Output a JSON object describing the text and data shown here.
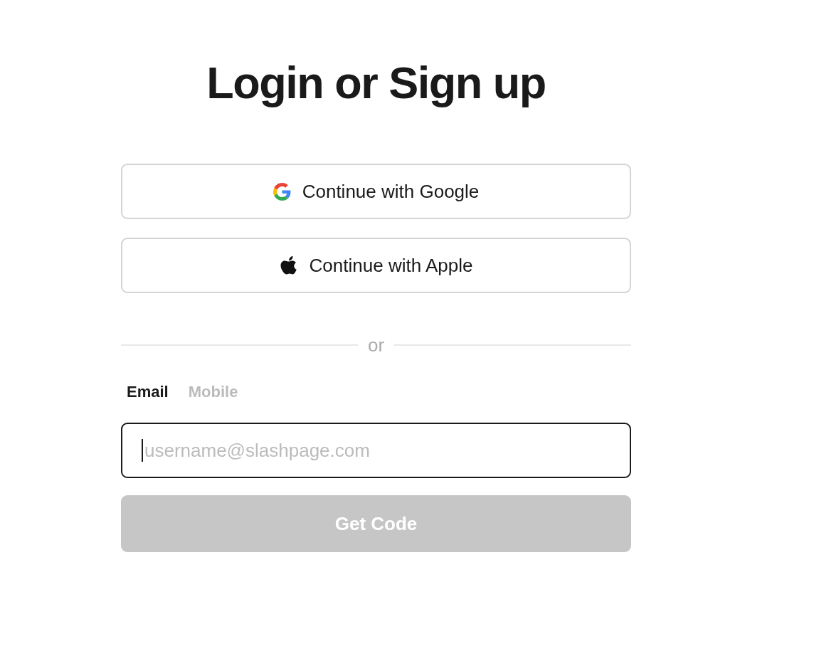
{
  "title": "Login or Sign up",
  "social_buttons": [
    {
      "kind": "google",
      "label": "Continue with Google"
    },
    {
      "kind": "apple",
      "label": "Continue with Apple"
    }
  ],
  "divider": "or",
  "tabs": [
    {
      "label": "Email",
      "selected": true
    },
    {
      "label": "Mobile",
      "selected": false
    }
  ],
  "email_field": {
    "placeholder": "username@slashpage.com",
    "focused": true
  },
  "submit": {
    "label": "Get Code",
    "disabled": true
  }
}
